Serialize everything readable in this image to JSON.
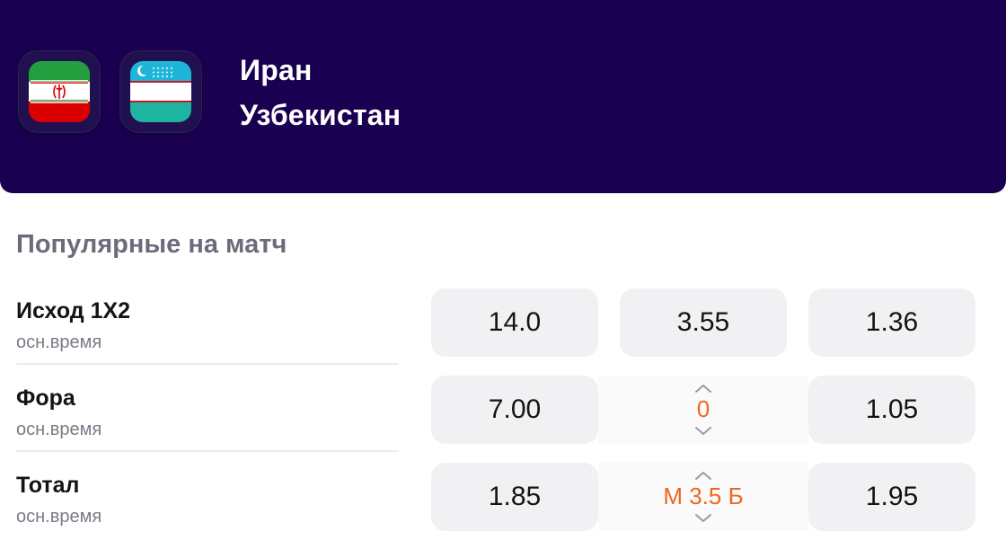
{
  "header": {
    "team_home": "Иран",
    "team_away": "Узбекистан",
    "bg_color": "#1a0050",
    "home_flag_icon": "iran-flag-icon",
    "away_flag_icon": "uzbekistan-flag-icon"
  },
  "section": {
    "title": "Популярные на матч"
  },
  "markets": [
    {
      "name": "Исход 1X2",
      "sub": "осн.время",
      "odds": [
        "14.0",
        "3.55",
        "1.36"
      ]
    },
    {
      "name": "Фора",
      "sub": "осн.время",
      "odds": [
        "7.00",
        "1.05"
      ],
      "param": "0"
    },
    {
      "name": "Тотал",
      "sub": "осн.время",
      "odds": [
        "1.85",
        "1.95"
      ],
      "param": "М 3.5 Б"
    }
  ],
  "colors": {
    "accent": "#f0661e",
    "odd_bg": "#f1f1f4"
  }
}
